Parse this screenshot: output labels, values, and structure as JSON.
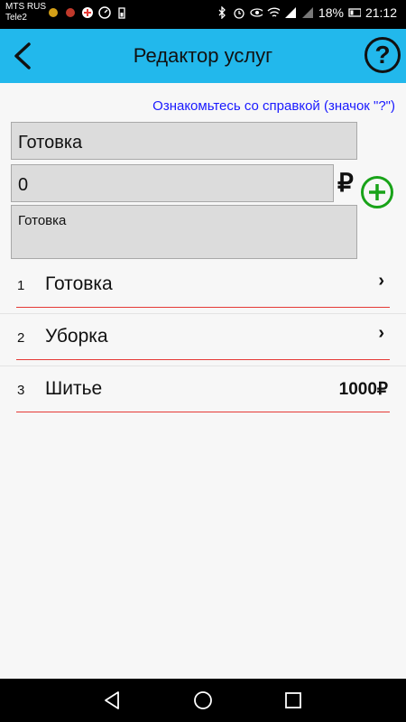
{
  "status_bar": {
    "carrier_1": "MTS RUS",
    "carrier_2": "Tele2",
    "battery": "18%",
    "time": "21:12"
  },
  "app_bar": {
    "title": "Редактор услуг",
    "help_label": "?"
  },
  "hint": "Ознакомьтесь со справкой (значок \"?\")",
  "form": {
    "name_value": "Готовка",
    "price_value": "0",
    "currency_symbol": "₽",
    "description_value": "Готовка"
  },
  "services": [
    {
      "num": "1",
      "name": "Готовка",
      "arrow": "›",
      "price": ""
    },
    {
      "num": "2",
      "name": "Уборка",
      "arrow": "›",
      "price": ""
    },
    {
      "num": "3",
      "name": "Шитье",
      "arrow": "",
      "price": "1000₽"
    }
  ],
  "colors": {
    "app_bar": "#22b8ec",
    "hint": "#1a1aff",
    "add_button": "#19a319",
    "row_line": "#e53935"
  }
}
